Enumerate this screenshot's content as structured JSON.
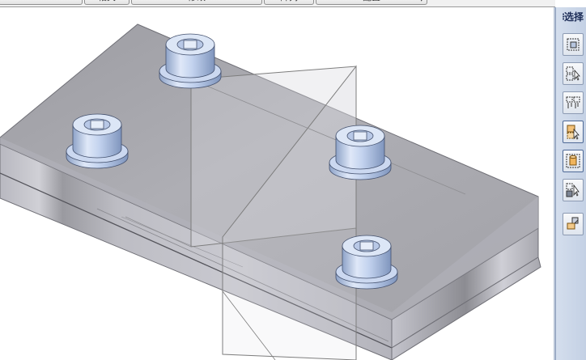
{
  "toolbar": {
    "tabs": [
      {
        "label": ""
      },
      {
        "label": "相关"
      },
      {
        "label": "修改"
      },
      {
        "label": "阵列"
      },
      {
        "label": "配置"
      }
    ]
  },
  "select_panel": {
    "title": "选择",
    "tools": [
      {
        "icon": "box-select-icon"
      },
      {
        "icon": "select-pointer-icon"
      },
      {
        "icon": "multi-select-icon"
      },
      {
        "icon": "part-select-icon"
      },
      {
        "icon": "cylinder-select-icon"
      },
      {
        "icon": "select-move-icon"
      },
      {
        "icon": "face-select-icon"
      }
    ]
  },
  "colors": {
    "panel_bg": "#c8d4e6",
    "plate_top": "#a8a8ae",
    "plate_side": "#bcbcc4",
    "bushing": "#c4d4ee",
    "plane_edges": "#7d7d7d"
  }
}
